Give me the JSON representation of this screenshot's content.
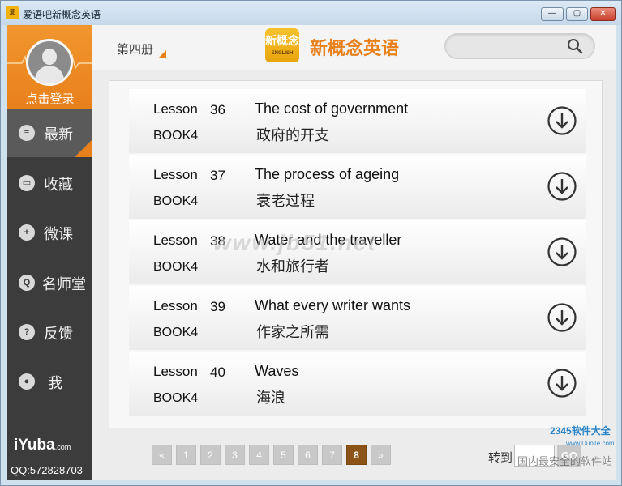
{
  "window": {
    "icon_text": "爱",
    "title": "爱语吧新概念英语",
    "minimize": "—",
    "maximize": "▢",
    "close": "✕"
  },
  "sidebar": {
    "login_text": "点击登录",
    "items": [
      {
        "label": "最新",
        "icon": "new-icon",
        "glyph": "≡",
        "active": true
      },
      {
        "label": "收藏",
        "icon": "favorites-icon",
        "glyph": "▭",
        "active": false
      },
      {
        "label": "微课",
        "icon": "micro-course-icon",
        "glyph": "+",
        "active": false
      },
      {
        "label": "名师堂",
        "icon": "teacher-icon",
        "glyph": "Q",
        "active": false
      },
      {
        "label": "反馈",
        "icon": "feedback-icon",
        "glyph": "?",
        "active": false
      },
      {
        "label": "我",
        "icon": "profile-icon",
        "glyph": "●",
        "active": false
      }
    ],
    "brand": "iYuba",
    "brand_suffix": ".com",
    "qq": "QQ:572828703"
  },
  "header": {
    "book_selector": "第四册",
    "logo_glyph": "新概念",
    "logo_sub": "ENGLISH",
    "app_name": "新概念英语",
    "search_placeholder": ""
  },
  "lessons": [
    {
      "word": "Lesson",
      "number": "36",
      "book": "BOOK4",
      "title": "The cost of government",
      "title_cn": "政府的开支"
    },
    {
      "word": "Lesson",
      "number": "37",
      "book": "BOOK4",
      "title": "The process of ageing",
      "title_cn": "衰老过程"
    },
    {
      "word": "Lesson",
      "number": "38",
      "book": "BOOK4",
      "title": "Water and the traveller",
      "title_cn": "水和旅行者"
    },
    {
      "word": "Lesson",
      "number": "39",
      "book": "BOOK4",
      "title": "What every writer wants",
      "title_cn": "作家之所需"
    },
    {
      "word": "Lesson",
      "number": "40",
      "book": "BOOK4",
      "title": "Waves",
      "title_cn": "海浪"
    }
  ],
  "pagination": {
    "prev": "«",
    "pages": [
      "1",
      "2",
      "3",
      "4",
      "5",
      "6",
      "7",
      "8"
    ],
    "current": "8",
    "next": "»",
    "goto_label": "转到",
    "goto_value": "",
    "go_label": "GO"
  },
  "watermarks": {
    "center": "www.jb51.net",
    "corner_top": "2345软件大全",
    "corner_url": "www.DuoTe.com",
    "corner_bottom": "国内最安全的软件站"
  },
  "colors": {
    "accent": "#e8801c",
    "sidebar_bg": "#3c3c3c",
    "current_page": "#8b5316"
  }
}
